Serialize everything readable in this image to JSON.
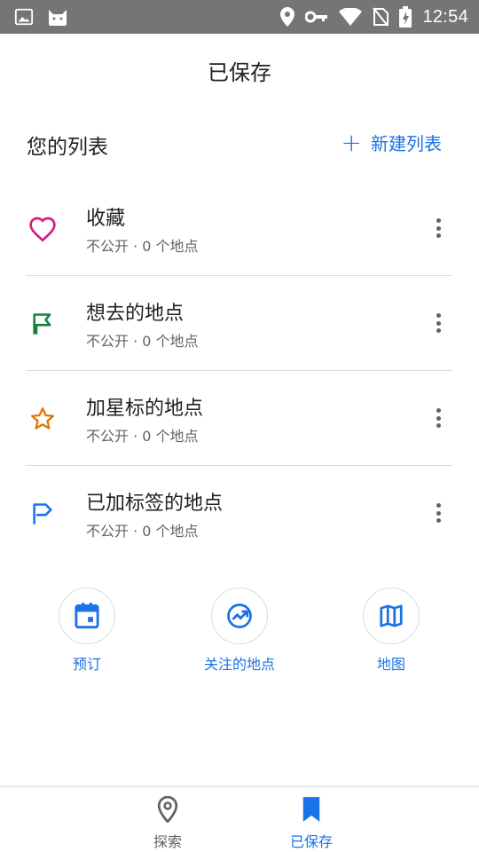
{
  "status_bar": {
    "time": "12:54",
    "icons": [
      "image-icon",
      "cat-icon",
      "location-icon",
      "key-icon",
      "wifi-icon",
      "no-sim-icon",
      "battery-charging-icon"
    ]
  },
  "header": {
    "title": "已保存"
  },
  "lists_section": {
    "title": "您的列表",
    "new_list_label": "新建列表",
    "new_list_icon": "plus-icon"
  },
  "lists": [
    {
      "name": "收藏",
      "meta": "不公开 · 0 个地点",
      "icon": "heart-icon",
      "color": "#d81b84"
    },
    {
      "name": "想去的地点",
      "meta": "不公开 · 0 个地点",
      "icon": "flag-icon",
      "color": "#188038"
    },
    {
      "name": "加星标的地点",
      "meta": "不公开 · 0 个地点",
      "icon": "star-icon",
      "color": "#e37400"
    },
    {
      "name": "已加标签的地点",
      "meta": "不公开 · 0 个地点",
      "icon": "label-flag-icon",
      "color": "#1a73e8"
    }
  ],
  "shortcuts": [
    {
      "label": "预订",
      "icon": "calendar-icon"
    },
    {
      "label": "关注的地点",
      "icon": "trending-icon"
    },
    {
      "label": "地图",
      "icon": "map-icon"
    }
  ],
  "bottom_nav": {
    "items": [
      {
        "label": "探索",
        "icon": "place-pin-icon",
        "active": false
      },
      {
        "label": "已保存",
        "icon": "bookmark-icon",
        "active": true
      }
    ],
    "active_color": "#1a73e8",
    "inactive_color": "#5f6368"
  },
  "accent_color": "#1a73e8"
}
